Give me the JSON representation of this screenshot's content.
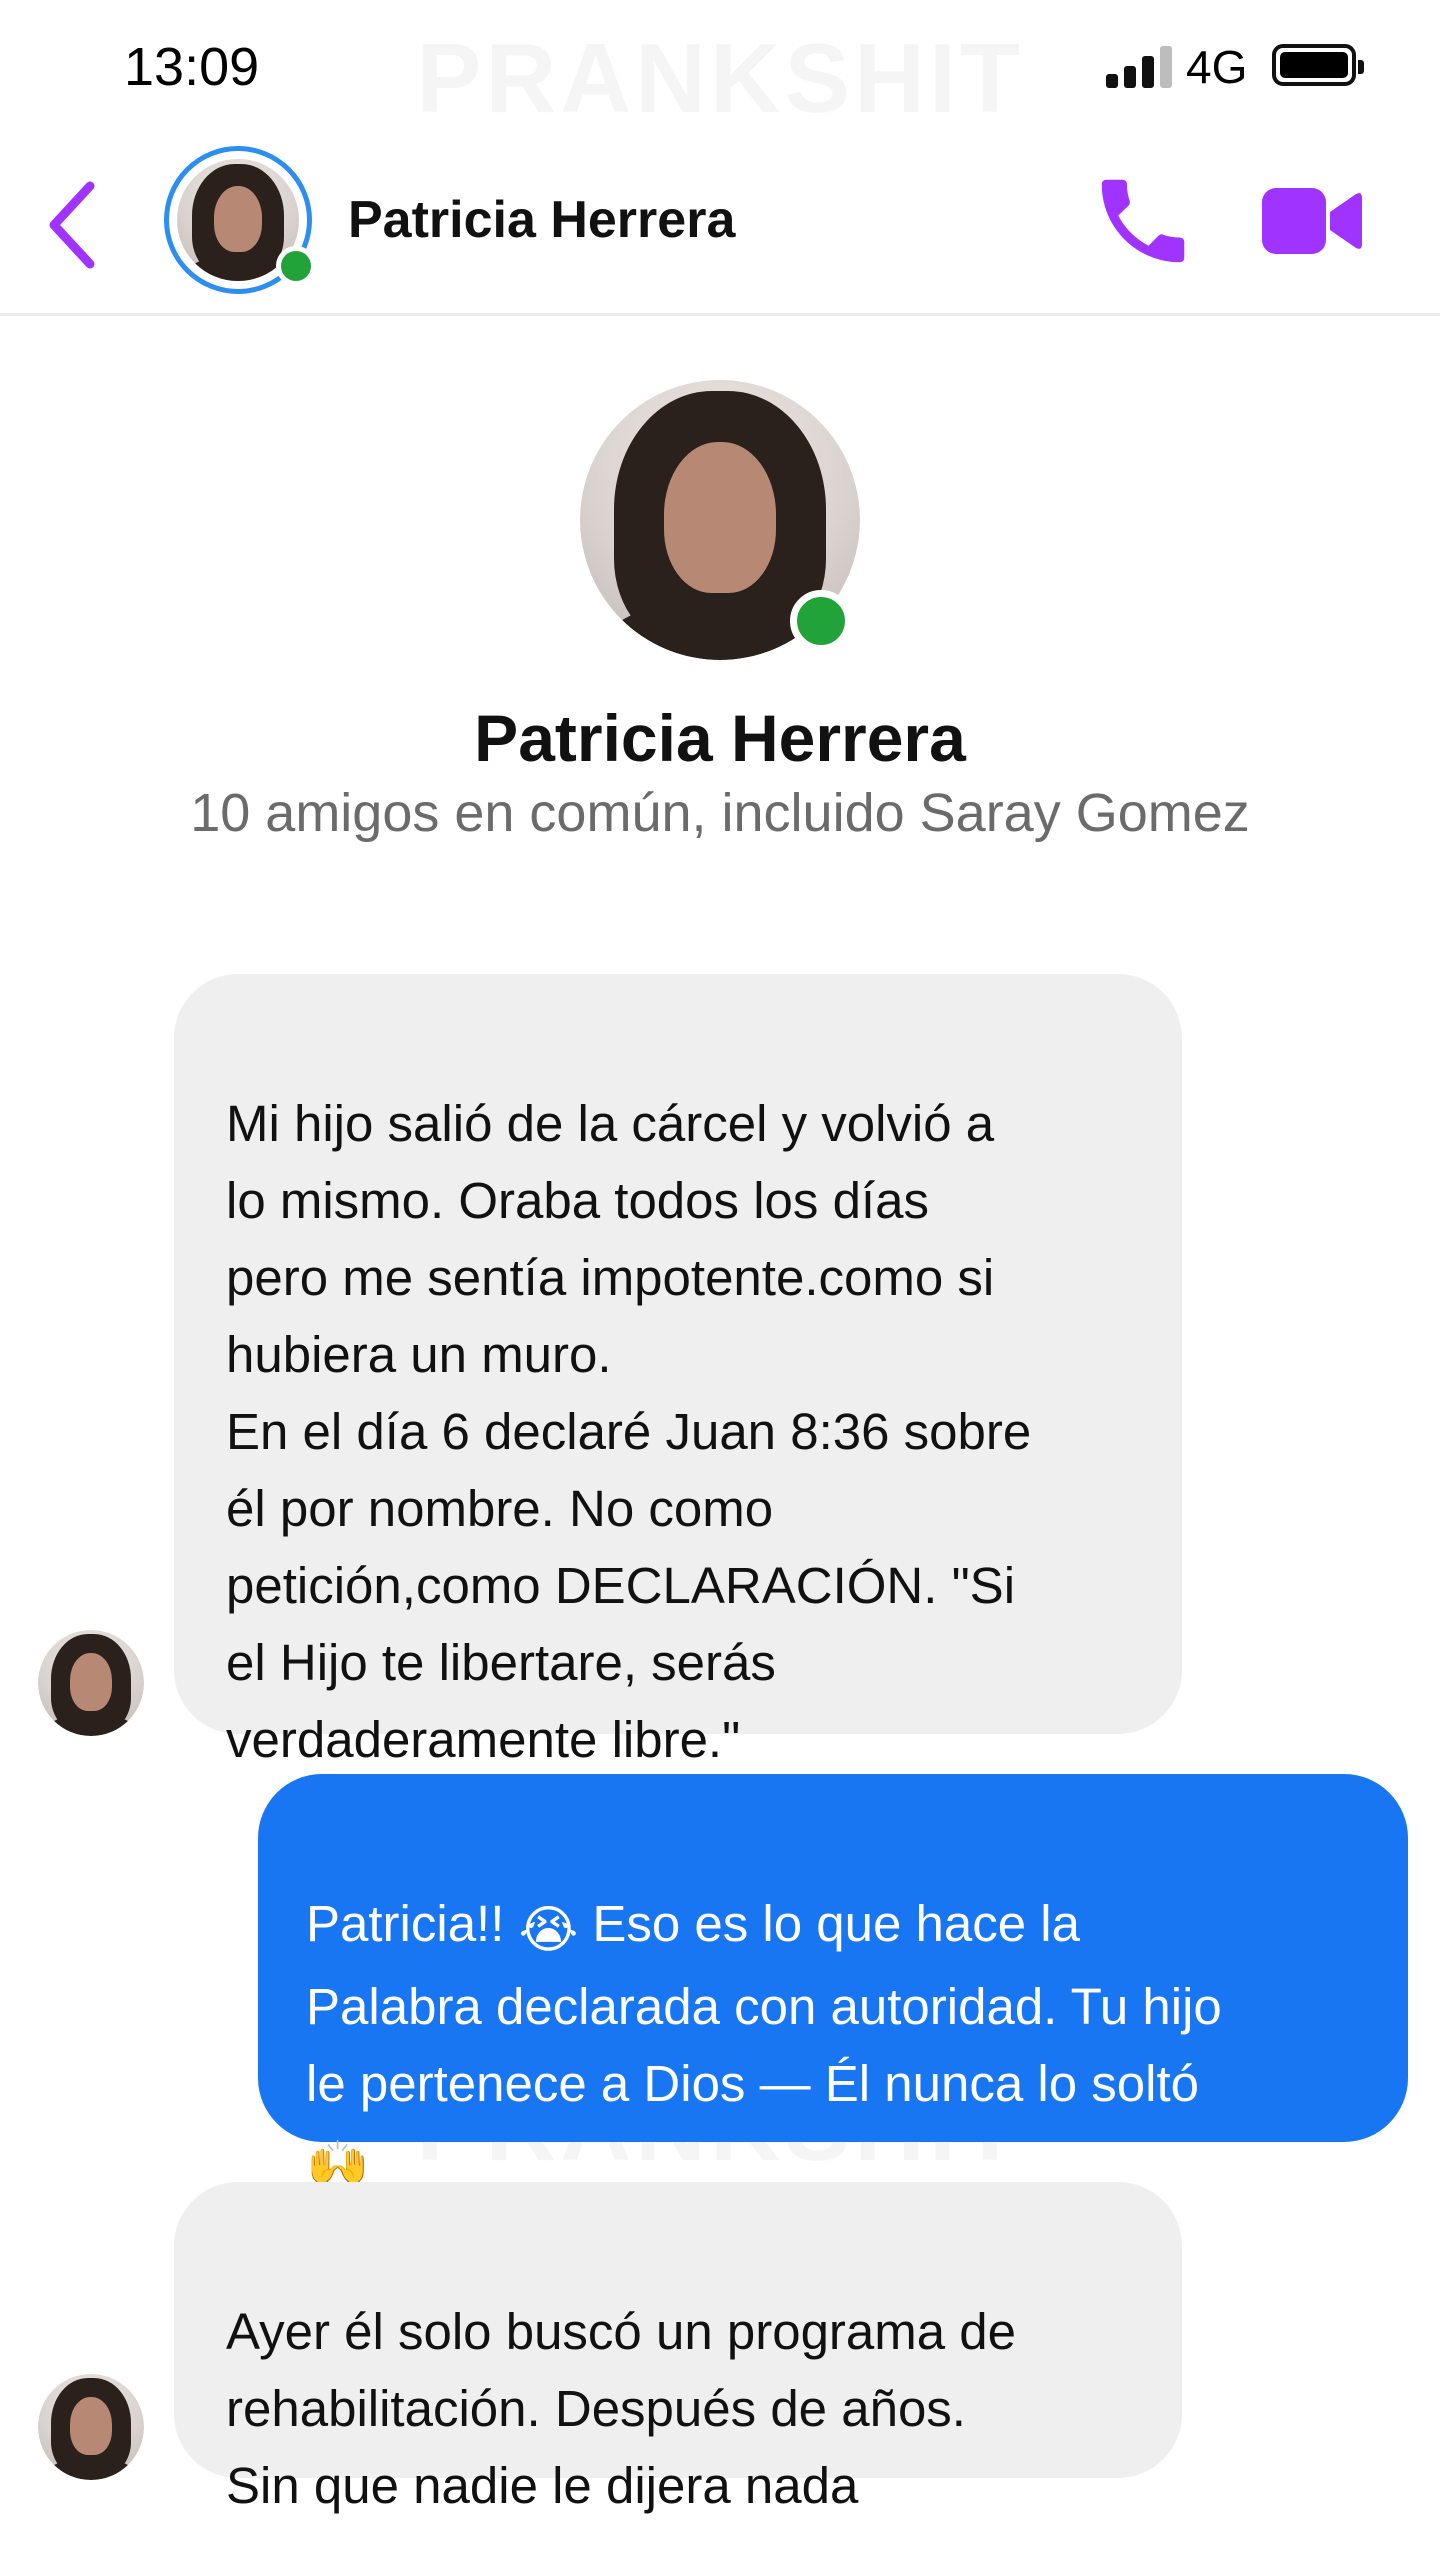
{
  "status_bar": {
    "time": "13:09",
    "network": "4G",
    "watermark": "PRANKSHIT"
  },
  "header": {
    "back_icon": "chevron-left-icon",
    "contact_name": "Patricia Herrera",
    "online": true,
    "call_icon": "phone-icon",
    "video_icon": "video-camera-icon",
    "accent_color": "#a033ff"
  },
  "profile": {
    "name": "Patricia Herrera",
    "mutual_friends": "10 amigos en común, incluido Saray Gomez"
  },
  "messages": [
    {
      "direction": "incoming",
      "text": "Mi hijo salió de la cárcel y volvió a\nlo mismo. Oraba todos los días\npero me sentía impotente.como si\nhubiera un muro.\nEn el día 6 declaré Juan 8:36 sobre\nél por nombre. No como\npetición,como DECLARACIÓN. \"Si\nel Hijo te libertare, serás\nverdaderamente libre.\""
    },
    {
      "direction": "outgoing",
      "text_part1": "Patricia!! ",
      "emoji1": "😭",
      "text_part2": " Eso es lo que hace la\nPalabra declarada con autoridad. Tu hijo\nle pertenece a Dios — Él nunca lo soltó\n",
      "emoji2": "🙌",
      "bubble_color": "#1876f2"
    },
    {
      "direction": "incoming",
      "text": "Ayer él solo buscó un programa de\nrehabilitación. Después de años.\nSin que nadie le dijera nada"
    }
  ],
  "colors": {
    "incoming_bubble": "#efefef",
    "outgoing_bubble": "#1876f2",
    "online_dot": "#22a33a",
    "avatar_ring": "#2b8ef0"
  }
}
